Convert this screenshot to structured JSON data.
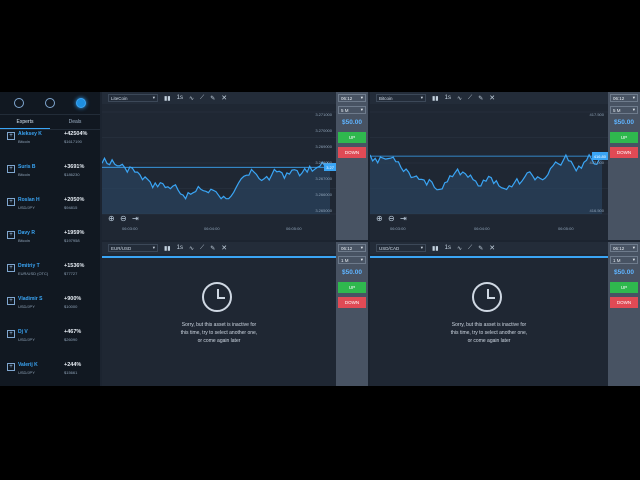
{
  "sidebar": {
    "tabs": [
      "Experts",
      "Deals"
    ],
    "experts": [
      {
        "name": "Aleksey K",
        "asset": "Bitcoin",
        "pct": "+42504%",
        "amount": "$1617190"
      },
      {
        "name": "Suris B",
        "asset": "Bitcoin",
        "pct": "+3691%",
        "amount": "$186230"
      },
      {
        "name": "Roslan H",
        "asset": "USD/JPY",
        "pct": "+2050%",
        "amount": "$94815"
      },
      {
        "name": "Davy R",
        "asset": "Bitcoin",
        "pct": "+1959%",
        "amount": "$197958"
      },
      {
        "name": "Dmitriy T",
        "asset": "EUR/USD (OTC)",
        "pct": "+1536%",
        "amount": "$77727"
      },
      {
        "name": "Vladimir S",
        "asset": "USD/JPY",
        "pct": "+900%",
        "amount": "$10000"
      },
      {
        "name": "Dj V",
        "asset": "USD/JPY",
        "pct": "+467%",
        "amount": "$26090"
      },
      {
        "name": "Valerij K",
        "asset": "USD/JPY",
        "pct": "+244%",
        "amount": "$15661"
      }
    ]
  },
  "panels": [
    {
      "asset": "LiteCoin",
      "time": "06:12",
      "duration": "5 M",
      "amount": "$50.00",
      "up_label": "UP",
      "down_label": "DOWN",
      "y_labels": [
        "3.271000",
        "3.270000",
        "3.269000",
        "3.268000",
        "3.267000",
        "3.266000",
        "3.265000"
      ],
      "x_labels": [
        "06:03:00",
        "06:04:00",
        "06:05:00"
      ],
      "current_price": "3.27"
    },
    {
      "asset": "Bitcoin",
      "time": "06:12",
      "duration": "5 M",
      "amount": "$50.00",
      "up_label": "UP",
      "down_label": "DOWN",
      "y_labels": [
        "417.500",
        "417.000",
        "416.500"
      ],
      "x_labels": [
        "06:03:00",
        "06:04:00",
        "06:05:00"
      ],
      "current_price": "416.80"
    },
    {
      "asset": "EUR/USD",
      "time": "06:12",
      "duration": "1 M",
      "amount": "$50.00",
      "up_label": "UP",
      "down_label": "DOWN",
      "message": [
        "Sorry, but this asset is inactive for",
        "this time, try to select another one,",
        "or come again later"
      ]
    },
    {
      "asset": "USD/CAD",
      "time": "06:12",
      "duration": "1 M",
      "amount": "$50.00",
      "up_label": "UP",
      "down_label": "DOWN",
      "message": [
        "Sorry, but this asset is inactive for",
        "this time, try to select another one,",
        "or come again later"
      ]
    }
  ],
  "colors": {
    "accent": "#3aa5f5",
    "up": "#2fb84e",
    "down": "#e04a55",
    "line": "#3aa5f5"
  },
  "icons": [
    "person-icon",
    "globe-icon",
    "power-icon",
    "candle-icon",
    "timeframe-icon",
    "indicator-icon",
    "draw-icon",
    "pencil-icon",
    "close-icon",
    "zoom-in-icon",
    "zoom-out-icon",
    "scroll-icon",
    "clock-icon"
  ]
}
